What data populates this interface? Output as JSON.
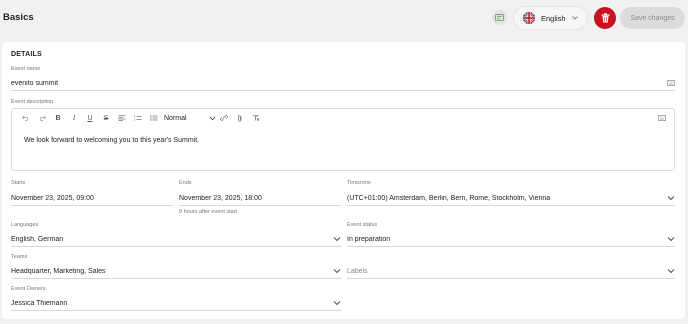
{
  "header": {
    "title": "Basics",
    "language": "English",
    "save_label": "Save changes"
  },
  "details": {
    "section_title": "DETAILS",
    "event_name": {
      "label": "Event name",
      "value": "evenito summit"
    },
    "event_description": {
      "label": "Event description",
      "format": "Normal",
      "text": "We look forward to welcoming you to this year's Summit."
    },
    "starts": {
      "label": "Starts",
      "value": "November 23, 2025, 09:00"
    },
    "ends": {
      "label": "Ends",
      "value": "November 23, 2025, 18:00",
      "hint": "9 hours after event start"
    },
    "timezone": {
      "label": "Timezone",
      "value": "(UTC+01:00) Amsterdam, Berlin, Bern, Rome, Stockholm, Vienna"
    },
    "languages": {
      "label": "Languages",
      "value": "English, German"
    },
    "event_status": {
      "label": "Event status",
      "value": "In preparation"
    },
    "teams": {
      "label": "Teams",
      "value": "Headquarter, Marketing, Sales"
    },
    "labels": {
      "placeholder": "Labels"
    },
    "event_owners": {
      "label": "Event Owners",
      "value": "Jessica Thiemann"
    }
  },
  "colors": {
    "background": "#f1f1f1",
    "card": "#ffffff",
    "delete": "#c8141e",
    "save_disabled_bg": "#dcdcdc",
    "translation_icon": "#5a9a5a"
  },
  "icons": [
    "translate-icon",
    "uk-flag-icon",
    "chevron-down-icon",
    "trash-icon",
    "keyboard-icon",
    "undo-icon",
    "redo-icon",
    "bold-icon",
    "italic-icon",
    "underline-icon",
    "strikethrough-icon",
    "align-icon",
    "ordered-list-icon",
    "bullet-list-icon",
    "link-icon",
    "attachment-icon",
    "clear-format-icon"
  ]
}
